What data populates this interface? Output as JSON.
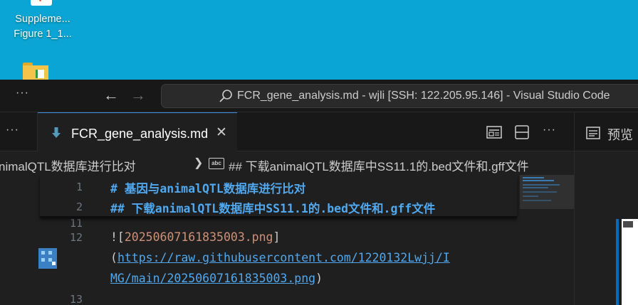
{
  "desktop": {
    "icon_label_line1": "Suppleme...",
    "icon_label_line2": "Figure 1_1..."
  },
  "titlebar": {
    "command_center_text": "FCR_gene_analysis.md - wjli [SSH: 122.205.95.146] - Visual Studio Code",
    "more_glyph": "···",
    "back_glyph": "←",
    "forward_glyph": "→"
  },
  "tabs": {
    "left_more_glyph": "···",
    "active_tab_label": "FCR_gene_analysis.md",
    "close_glyph": "✕",
    "actions_more_glyph": "···",
    "preview_tab_label": "预览"
  },
  "breadcrumb": {
    "item1": "nimalQTL数据库进行比对",
    "separator": "❯",
    "symbol_badge": "abc",
    "item2": "## 下载animalQTL数据库中SS11.1的.bed文件和.gff文件"
  },
  "editor": {
    "sticky": [
      {
        "line": "1",
        "marker": "#",
        "text": " 基因与animalQTL数据库进行比对"
      },
      {
        "line": "2",
        "marker": "##",
        "text": " 下载animalQTL数据库中SS11.1的.bed文件和.gff文件"
      }
    ],
    "hidden_line_number": "11",
    "line12_number": "12",
    "line12_open": "![",
    "line12_alt": "20250607161835003.png",
    "line12_close": "]",
    "line12_paren_open": "(",
    "line12_url_part1": "https://raw.githubusercontent.com/1220132Lwjj/I",
    "line12_url_part2": "MG/main/20250607161835003.png",
    "line12_paren_close": ")",
    "line13_number": "13"
  },
  "colors": {
    "accent": "#3a8ee6",
    "heading": "#4fa8f0",
    "string": "#ce9178",
    "desktop_bg": "#0aa5d4"
  },
  "icons": [
    "search-icon",
    "markdown-file-icon",
    "open-preview-icon",
    "split-editor-icon",
    "symbol-string-icon",
    "image-thumbnail-icon",
    "folder-icon"
  ]
}
